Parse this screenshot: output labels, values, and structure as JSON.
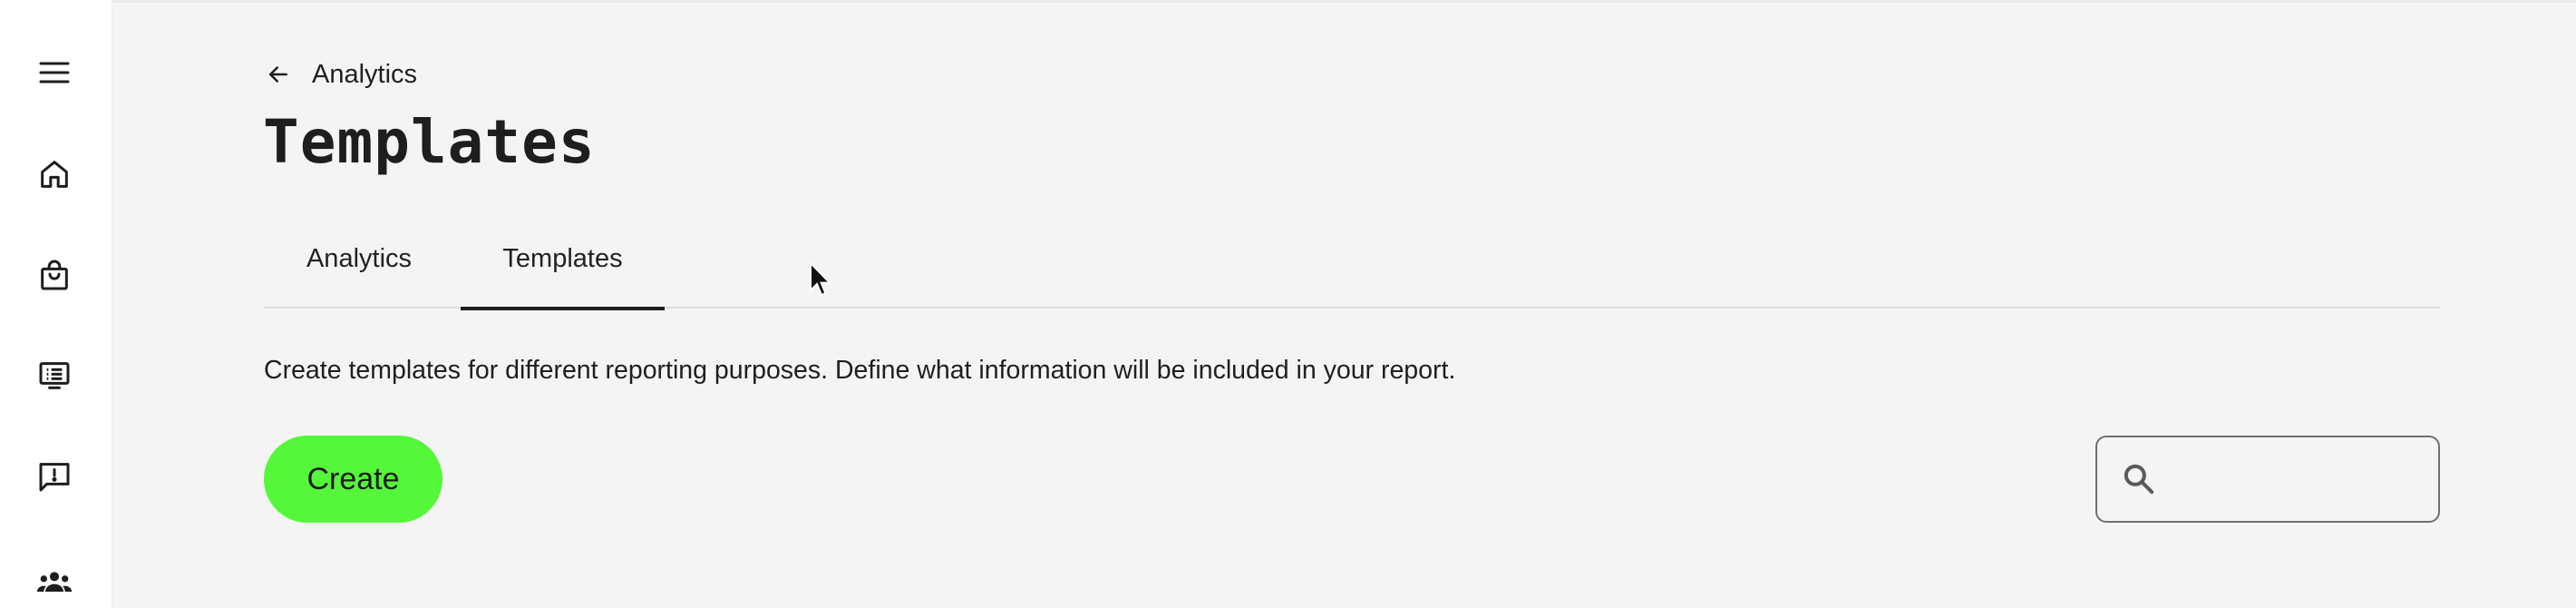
{
  "sidebar": {
    "items": [
      {
        "icon": "menu-icon"
      },
      {
        "icon": "home-icon"
      },
      {
        "icon": "shopping-bag-icon"
      },
      {
        "icon": "list-document-icon"
      },
      {
        "icon": "feedback-alert-icon"
      },
      {
        "icon": "users-group-icon"
      }
    ]
  },
  "breadcrumb": {
    "icon": "arrow-left-icon",
    "label": "Analytics"
  },
  "page": {
    "title": "Templates"
  },
  "tabs": [
    {
      "label": "Analytics",
      "active": false
    },
    {
      "label": "Templates",
      "active": true
    }
  ],
  "main": {
    "description": "Create templates for different reporting purposes. Define what information will be included in your report."
  },
  "toolbar": {
    "create_label": "Create",
    "search_value": "",
    "search_icon": "search-icon"
  },
  "colors": {
    "accent_green": "#55f73a",
    "background": "#f4f4f4",
    "sidebar": "#ffffff",
    "text": "#1a1a1a"
  }
}
